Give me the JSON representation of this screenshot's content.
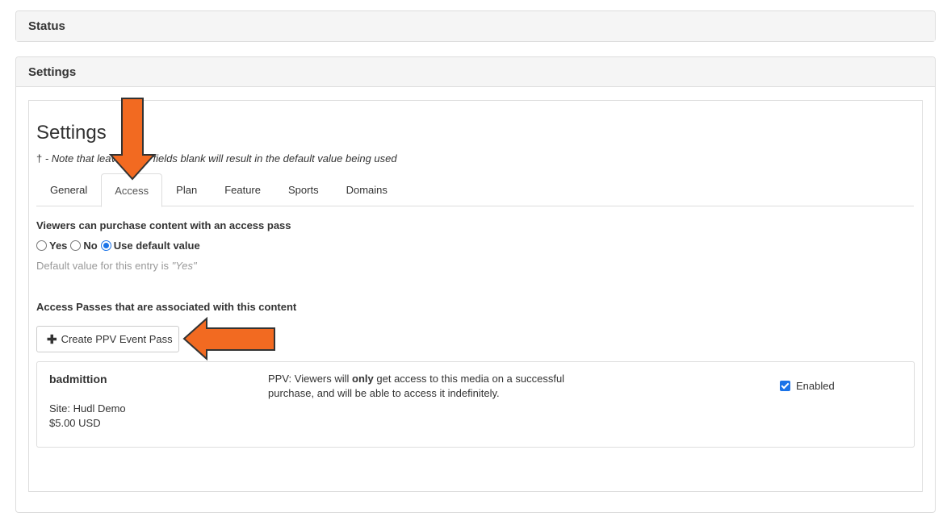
{
  "status_panel": {
    "title": "Status"
  },
  "settings_panel": {
    "title": "Settings",
    "heading": "Settings",
    "note": {
      "dagger": "†",
      "text": " - Note that leaving any fields blank will result in the default value being used"
    },
    "tabs": [
      {
        "label": "General",
        "active": false
      },
      {
        "label": "Access",
        "active": true
      },
      {
        "label": "Plan",
        "active": false
      },
      {
        "label": "Feature",
        "active": false
      },
      {
        "label": "Sports",
        "active": false
      },
      {
        "label": "Domains",
        "active": false
      }
    ],
    "access": {
      "purchase_label": "Viewers can purchase content with an access pass",
      "options": [
        {
          "label": "Yes",
          "checked": false
        },
        {
          "label": "No",
          "checked": false
        },
        {
          "label": "Use default value",
          "checked": true
        }
      ],
      "default_hint_prefix": "Default value for this entry is ",
      "default_hint_value": "\"Yes\"",
      "passes_label": "Access Passes that are associated with this content",
      "create_button_label": "Create PPV Event Pass",
      "pass": {
        "name": "badmittion",
        "site": "Site: Hudl Demo",
        "price": "$5.00 USD",
        "desc_before": "PPV: Viewers will ",
        "desc_bold": "only",
        "desc_after": " get access to this media on a successful purchase, and will be able to access it indefinitely.",
        "enabled_label": "Enabled",
        "enabled": true
      }
    }
  },
  "icons": {
    "plus": "plus-icon",
    "arrow_down": "arrow-down-annotation",
    "arrow_left": "arrow-left-annotation"
  },
  "colors": {
    "arrow": "#f26a21",
    "arrow_border": "#333333",
    "accent": "#1a73e8"
  }
}
